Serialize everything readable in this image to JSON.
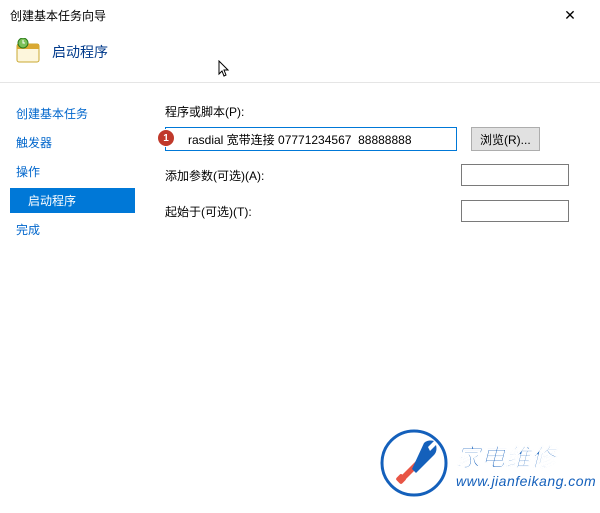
{
  "titlebar": {
    "title": "创建基本任务向导"
  },
  "header": {
    "title": "启动程序"
  },
  "sidebar": {
    "items": [
      {
        "label": "创建基本任务",
        "type": "main"
      },
      {
        "label": "触发器",
        "type": "main"
      },
      {
        "label": "操作",
        "type": "main"
      },
      {
        "label": "启动程序",
        "type": "sub",
        "selected": true
      },
      {
        "label": "完成",
        "type": "main"
      }
    ]
  },
  "form": {
    "script_label": "程序或脚本(P):",
    "script_value": "rasdial 宽带连接 07771234567  88888888",
    "browse_label": "浏览(R)...",
    "args_label": "添加参数(可选)(A):",
    "args_value": "",
    "startin_label": "起始于(可选)(T):",
    "startin_value": ""
  },
  "annotation": {
    "marker": "1"
  },
  "watermark": {
    "text": "家电维修",
    "url": "www.jianfeikang.com"
  }
}
